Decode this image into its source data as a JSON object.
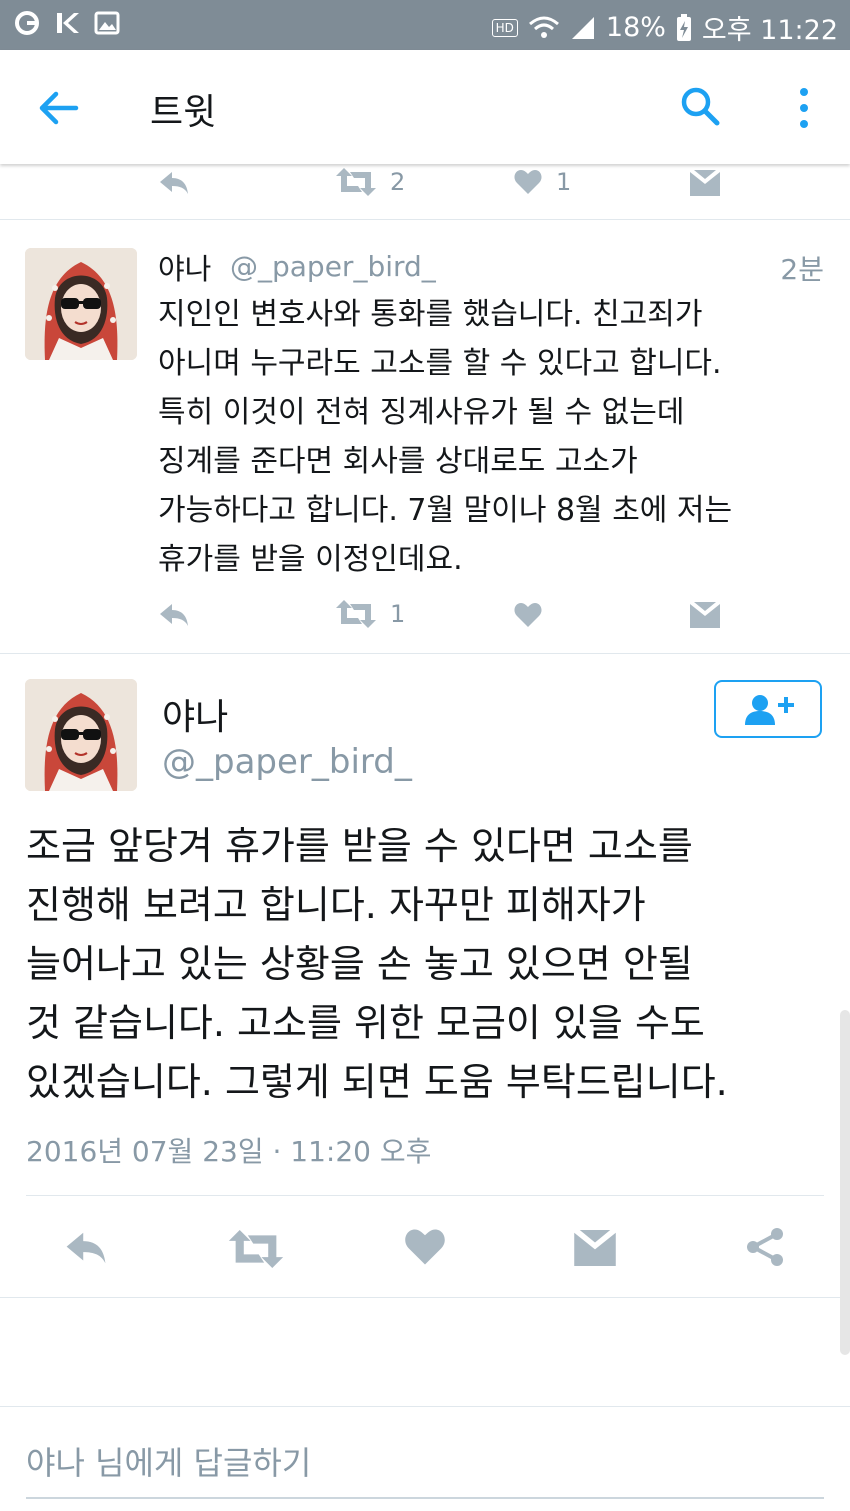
{
  "status_bar": {
    "battery": "18%",
    "time": "오후 11:22",
    "network_badge": "HD",
    "network_type": "G"
  },
  "app_bar": {
    "title": "트윗",
    "icons": [
      "arrow-left-icon",
      "search-icon",
      "more-vertical-icon"
    ],
    "accent_color": "#1da1f2"
  },
  "prev_tweet": {
    "retweet_count": "2",
    "like_count": "1"
  },
  "tweet1": {
    "name": "야나",
    "handle": "@_paper_bird_",
    "time_ago": "2분",
    "text": "지인인 변호사와 통화를 했습니다. 친고죄가\n아니며 누구라도 고소를 할 수 있다고 합니다.\n특히 이것이 전혀 징계사유가 될 수 없는데\n징계를 준다면 회사를 상대로도 고소가\n가능하다고 합니다. 7월 말이나 8월 초에 저는\n휴가를 받을 이정인데요.",
    "retweet_count": "1"
  },
  "tweet2": {
    "name": "야나",
    "handle": "@_paper_bird_",
    "text": "조금 앞당겨 휴가를 받을 수 있다면 고소를\n진행해 보려고 합니다. 자꾸만 피해자가\n늘어나고 있는 상황을 손 놓고 있으면 안될\n것 같습니다. 고소를 위한 모금이 있을 수도\n있겠습니다. 그렇게 되면 도움 부탁드립니다.",
    "date": "2016년 07월 23일 · 11:20 오후"
  },
  "reply": {
    "placeholder": "야나 님에게 답글하기"
  }
}
